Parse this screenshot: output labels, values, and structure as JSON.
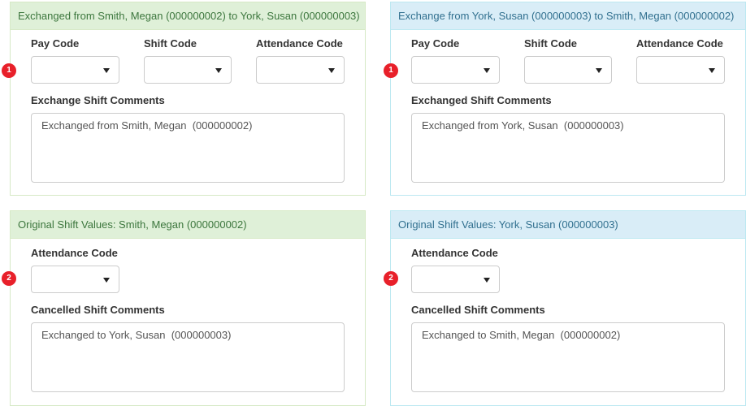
{
  "panels": {
    "top_left": {
      "header": "Exchanged from Smith, Megan (000000002) to York, Susan (000000003)",
      "badge": "1",
      "pay_code_label": "Pay Code",
      "shift_code_label": "Shift Code",
      "attendance_code_label": "Attendance Code",
      "comments_label": "Exchange Shift Comments",
      "comments_value": "Exchanged from Smith, Megan  (000000002)"
    },
    "top_right": {
      "header": "Exchange from York, Susan (000000003) to Smith, Megan (000000002)",
      "badge": "1",
      "pay_code_label": "Pay Code",
      "shift_code_label": "Shift Code",
      "attendance_code_label": "Attendance Code",
      "comments_label": "Exchanged Shift Comments",
      "comments_value": "Exchanged from York, Susan  (000000003)"
    },
    "bottom_left": {
      "header": "Original Shift Values: Smith, Megan (000000002)",
      "badge": "2",
      "attendance_code_label": "Attendance Code",
      "comments_label": "Cancelled Shift Comments",
      "comments_value": "Exchanged to York, Susan  (000000003)"
    },
    "bottom_right": {
      "header": "Original Shift Values: York, Susan (000000003)",
      "badge": "2",
      "attendance_code_label": "Attendance Code",
      "comments_label": "Cancelled Shift Comments",
      "comments_value": "Exchanged to Smith, Megan  (000000002)"
    }
  },
  "colors": {
    "green_header_bg": "#dff0d8",
    "green_header_text": "#3c763d",
    "blue_header_bg": "#d9edf7",
    "blue_header_text": "#31708f",
    "badge": "#e8202a"
  },
  "icons": {
    "dropdown": "caret-down-icon"
  }
}
